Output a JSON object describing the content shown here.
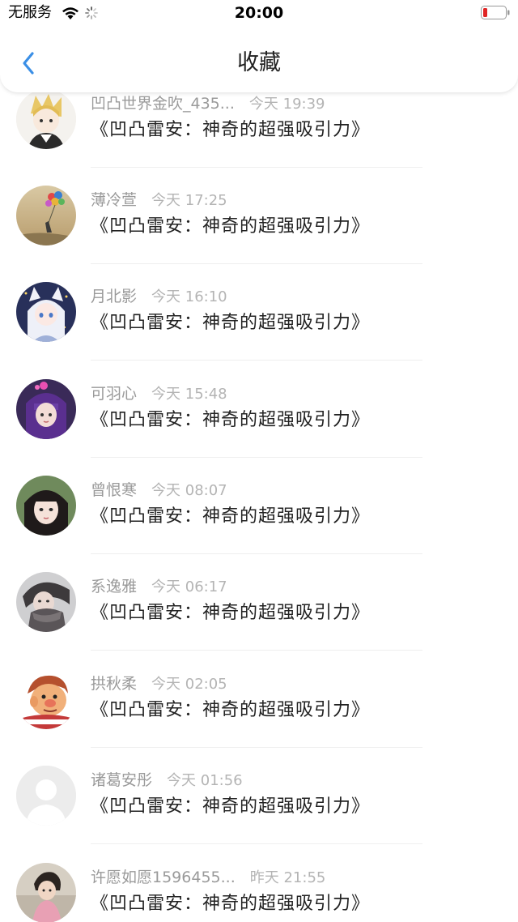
{
  "status_bar": {
    "carrier": "无服务",
    "time": "20:00"
  },
  "nav": {
    "title": "收藏",
    "back_icon": "chevron-left-icon",
    "accent": "#3b8fe6"
  },
  "favorites": [
    {
      "user": "凹凸世界金吹_435...",
      "time": "今天 19:39",
      "title": "《凹凸雷安：神奇的超强吸引力》",
      "avatar": "anime-blond-avatar"
    },
    {
      "user": "薄冷萱",
      "time": "今天 17:25",
      "title": "《凹凸雷安：神奇的超强吸引力》",
      "avatar": "balloons-avatar"
    },
    {
      "user": "月北影",
      "time": "今天 16:10",
      "title": "《凹凸雷安：神奇的超强吸引力》",
      "avatar": "anime-white-hair-avatar"
    },
    {
      "user": "可羽心",
      "time": "今天 15:48",
      "title": "《凹凸雷安：神奇的超强吸引力》",
      "avatar": "purple-hair-avatar"
    },
    {
      "user": "曾恨寒",
      "time": "今天 08:07",
      "title": "《凹凸雷安：神奇的超强吸引力》",
      "avatar": "girl-portrait-avatar"
    },
    {
      "user": "系逸雅",
      "time": "今天 06:17",
      "title": "《凹凸雷安：神奇的超强吸引力》",
      "avatar": "scarf-portrait-avatar"
    },
    {
      "user": "拱秋柔",
      "time": "今天 02:05",
      "title": "《凹凸雷安：神奇的超强吸引力》",
      "avatar": "cartoon-face-avatar"
    },
    {
      "user": "诸葛安彤",
      "time": "今天 01:56",
      "title": "《凹凸雷安：神奇的超强吸引力》",
      "avatar": "default-user-avatar"
    },
    {
      "user": "许愿如愿1596455...",
      "time": "昨天 21:55",
      "title": "《凹凸雷安：神奇的超强吸引力》",
      "avatar": "child-photo-avatar"
    }
  ]
}
